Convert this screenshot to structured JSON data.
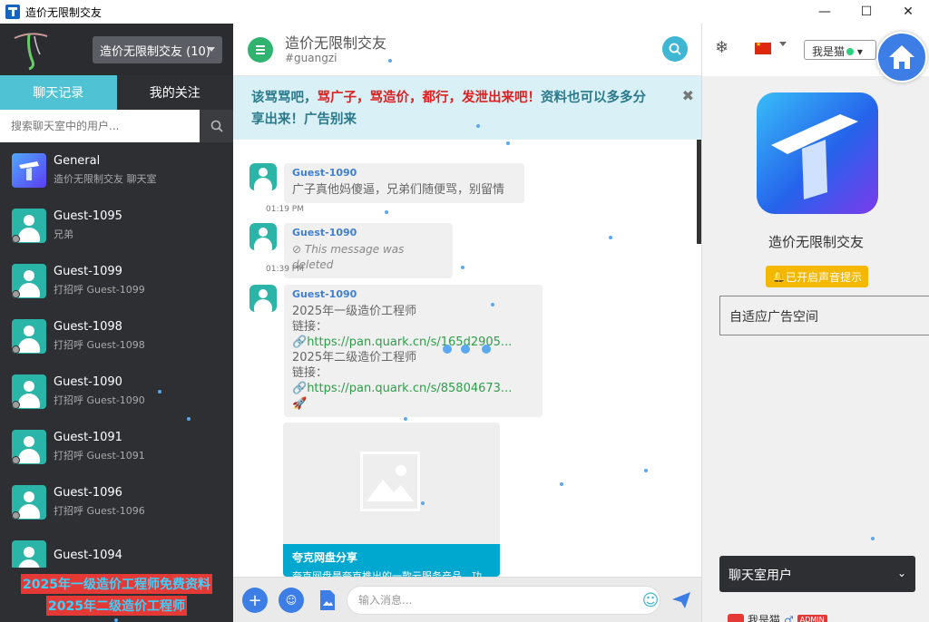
{
  "window": {
    "title": "造价无限制交友",
    "minimize": "—",
    "maximize": "☐",
    "close": "✕"
  },
  "sidebar": {
    "room_select": "造价无限制交友 (10)",
    "tabs": [
      {
        "label": "聊天记录"
      },
      {
        "label": "我的关注"
      }
    ],
    "search_placeholder": "搜索聊天室中的用户...",
    "contacts": [
      {
        "name": "General",
        "sub": "造价无限制交友 聊天室"
      },
      {
        "name": "Guest-1095",
        "sub": "兄弟"
      },
      {
        "name": "Guest-1099",
        "sub": "打招呼 Guest-1099"
      },
      {
        "name": "Guest-1098",
        "sub": "打招呼 Guest-1098"
      },
      {
        "name": "Guest-1090",
        "sub": "打招呼 Guest-1090"
      },
      {
        "name": "Guest-1091",
        "sub": "打招呼 Guest-1091"
      },
      {
        "name": "Guest-1096",
        "sub": "打招呼 Guest-1096"
      },
      {
        "name": "Guest-1094",
        "sub": ""
      }
    ],
    "promo": [
      "2025年一级造价工程师免费资料",
      "2025年二级造价工程师"
    ]
  },
  "chat": {
    "title": "造价无限制交友",
    "subtitle": "#guangzi",
    "notice": {
      "p1": "该骂骂吧，",
      "p2": "骂广子，骂造价，都行，发泄出来吧！",
      "p3": "资料也可以多多分享出来！广告别来",
      "close": "✖"
    },
    "messages": [
      {
        "sender": "Guest-1090",
        "text": "广子真他妈傻逼，兄弟们随便骂，别留情",
        "time": "01:19 PM"
      },
      {
        "sender": "Guest-1090",
        "text": "This message was deleted",
        "time": "01:39 PM"
      },
      {
        "sender": "Guest-1090",
        "l1": "2025年一级造价工程师",
        "l2": "链接：",
        "link1": "https://pan.quark.cn/s/165d2905...",
        "l3": "2025年二级造价工程师",
        "l4": "链接：",
        "link2": "https://pan.quark.cn/s/85804673...",
        "emoji": "🚀"
      }
    ],
    "card": {
      "title": "夸克网盘分享",
      "sub": "夸克网盘是夸克推出的一款云服务产品，功"
    },
    "input_placeholder": "输入消息..."
  },
  "right": {
    "brand_name": "造价无限制交友",
    "sound_badge": "已开启声音提示",
    "ad_box": "自适应广告空间",
    "users_dropdown": "聊天室用户",
    "me_label": "我是猫",
    "admin_tag": "ADMIN"
  },
  "header": {
    "user_button": "我是猫"
  }
}
